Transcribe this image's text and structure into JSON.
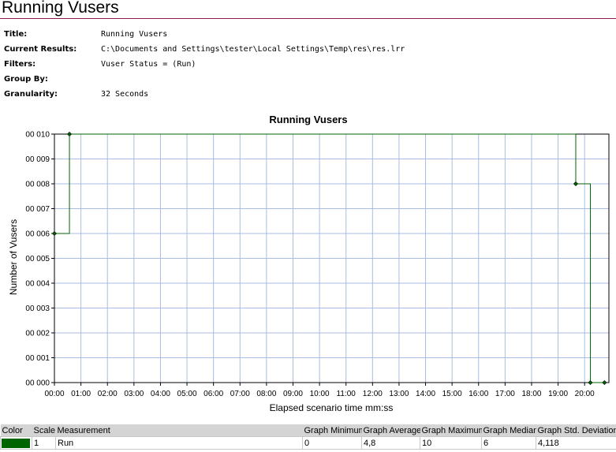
{
  "header": {
    "title": "Running Vusers"
  },
  "meta": [
    {
      "label": "Title:",
      "value": "Running Vusers"
    },
    {
      "label": "Current Results:",
      "value": "C:\\Documents and Settings\\tester\\Local Settings\\Temp\\res\\res.lrr"
    },
    {
      "label": "Filters:",
      "value": "Vuser Status = (Run)"
    },
    {
      "label": "Group By:",
      "value": ""
    },
    {
      "label": "Granularity:",
      "value": "32 Seconds"
    }
  ],
  "chart_data": {
    "type": "line",
    "title": "Running Vusers",
    "xlabel": "Elapsed scenario time mm:ss",
    "ylabel": "Number of Vusers",
    "xlim": [
      0,
      1255
    ],
    "ylim": [
      0,
      10
    ],
    "grid": true,
    "x_ticks": [
      {
        "value": 0,
        "label": "00:00"
      },
      {
        "value": 60,
        "label": "01:00"
      },
      {
        "value": 120,
        "label": "02:00"
      },
      {
        "value": 180,
        "label": "03:00"
      },
      {
        "value": 240,
        "label": "04:00"
      },
      {
        "value": 300,
        "label": "05:00"
      },
      {
        "value": 360,
        "label": "06:00"
      },
      {
        "value": 420,
        "label": "07:00"
      },
      {
        "value": 480,
        "label": "08:00"
      },
      {
        "value": 540,
        "label": "09:00"
      },
      {
        "value": 600,
        "label": "10:00"
      },
      {
        "value": 660,
        "label": "11:00"
      },
      {
        "value": 720,
        "label": "12:00"
      },
      {
        "value": 780,
        "label": "13:00"
      },
      {
        "value": 840,
        "label": "14:00"
      },
      {
        "value": 900,
        "label": "15:00"
      },
      {
        "value": 960,
        "label": "16:00"
      },
      {
        "value": 1020,
        "label": "17:00"
      },
      {
        "value": 1080,
        "label": "18:00"
      },
      {
        "value": 1140,
        "label": "19:00"
      },
      {
        "value": 1200,
        "label": "20:00"
      }
    ],
    "y_ticks": [
      {
        "value": 0,
        "label": "00 000"
      },
      {
        "value": 1,
        "label": "00 001"
      },
      {
        "value": 2,
        "label": "00 002"
      },
      {
        "value": 3,
        "label": "00 003"
      },
      {
        "value": 4,
        "label": "00 004"
      },
      {
        "value": 5,
        "label": "00 005"
      },
      {
        "value": 6,
        "label": "00 006"
      },
      {
        "value": 7,
        "label": "00 007"
      },
      {
        "value": 8,
        "label": "00 008"
      },
      {
        "value": 9,
        "label": "00 009"
      },
      {
        "value": 10,
        "label": "00 010"
      }
    ],
    "series": [
      {
        "name": "Run",
        "color": "#006400",
        "step": true,
        "points": [
          {
            "x": 0,
            "y": 6
          },
          {
            "x": 34,
            "y": 10
          },
          {
            "x": 1180,
            "y": 8
          },
          {
            "x": 1213,
            "y": 0
          },
          {
            "x": 1245,
            "y": 0
          }
        ]
      }
    ]
  },
  "legend": {
    "headers": [
      "Color",
      "Scale",
      "Measurement",
      "Graph Minimum",
      "Graph Average",
      "Graph Maximum",
      "Graph Median",
      "Graph Std. Deviation"
    ],
    "rows": [
      {
        "color": "#006400",
        "scale": "1",
        "measurement": "Run",
        "min": "0",
        "avg": "4,8",
        "max": "10",
        "median": "6",
        "std": "4,118"
      }
    ]
  }
}
